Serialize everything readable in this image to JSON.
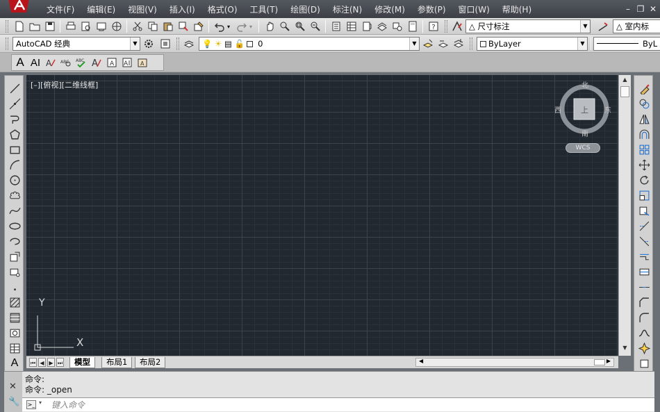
{
  "menu": [
    "文件(F)",
    "编辑(E)",
    "视图(V)",
    "插入(I)",
    "格式(O)",
    "工具(T)",
    "绘图(D)",
    "标注(N)",
    "修改(M)",
    "参数(P)",
    "窗口(W)",
    "帮助(H)"
  ],
  "window_controls": {
    "minimize": "–",
    "restore": "❐",
    "close": "✕"
  },
  "toolbar1": {
    "dim_style": "尺寸标注",
    "text_style": "室内标"
  },
  "toolbar2": {
    "workspace": "AutoCAD 经典",
    "layer": "0",
    "color": "ByLayer",
    "linetype": "ByL"
  },
  "viewport": {
    "label": "[–][俯视][二维线框]"
  },
  "viewcube": {
    "north": "北",
    "south": "南",
    "east": "东",
    "west": "西",
    "top_face": "上",
    "wcs": "WCS"
  },
  "ucs": {
    "x": "X",
    "y": "Y"
  },
  "layout_tabs": [
    {
      "label": "模型",
      "active": true
    },
    {
      "label": "布局1",
      "active": false
    },
    {
      "label": "布局2",
      "active": false
    }
  ],
  "command": {
    "history": [
      "命令:",
      "命令:  _open"
    ],
    "placeholder": "键入命令"
  }
}
